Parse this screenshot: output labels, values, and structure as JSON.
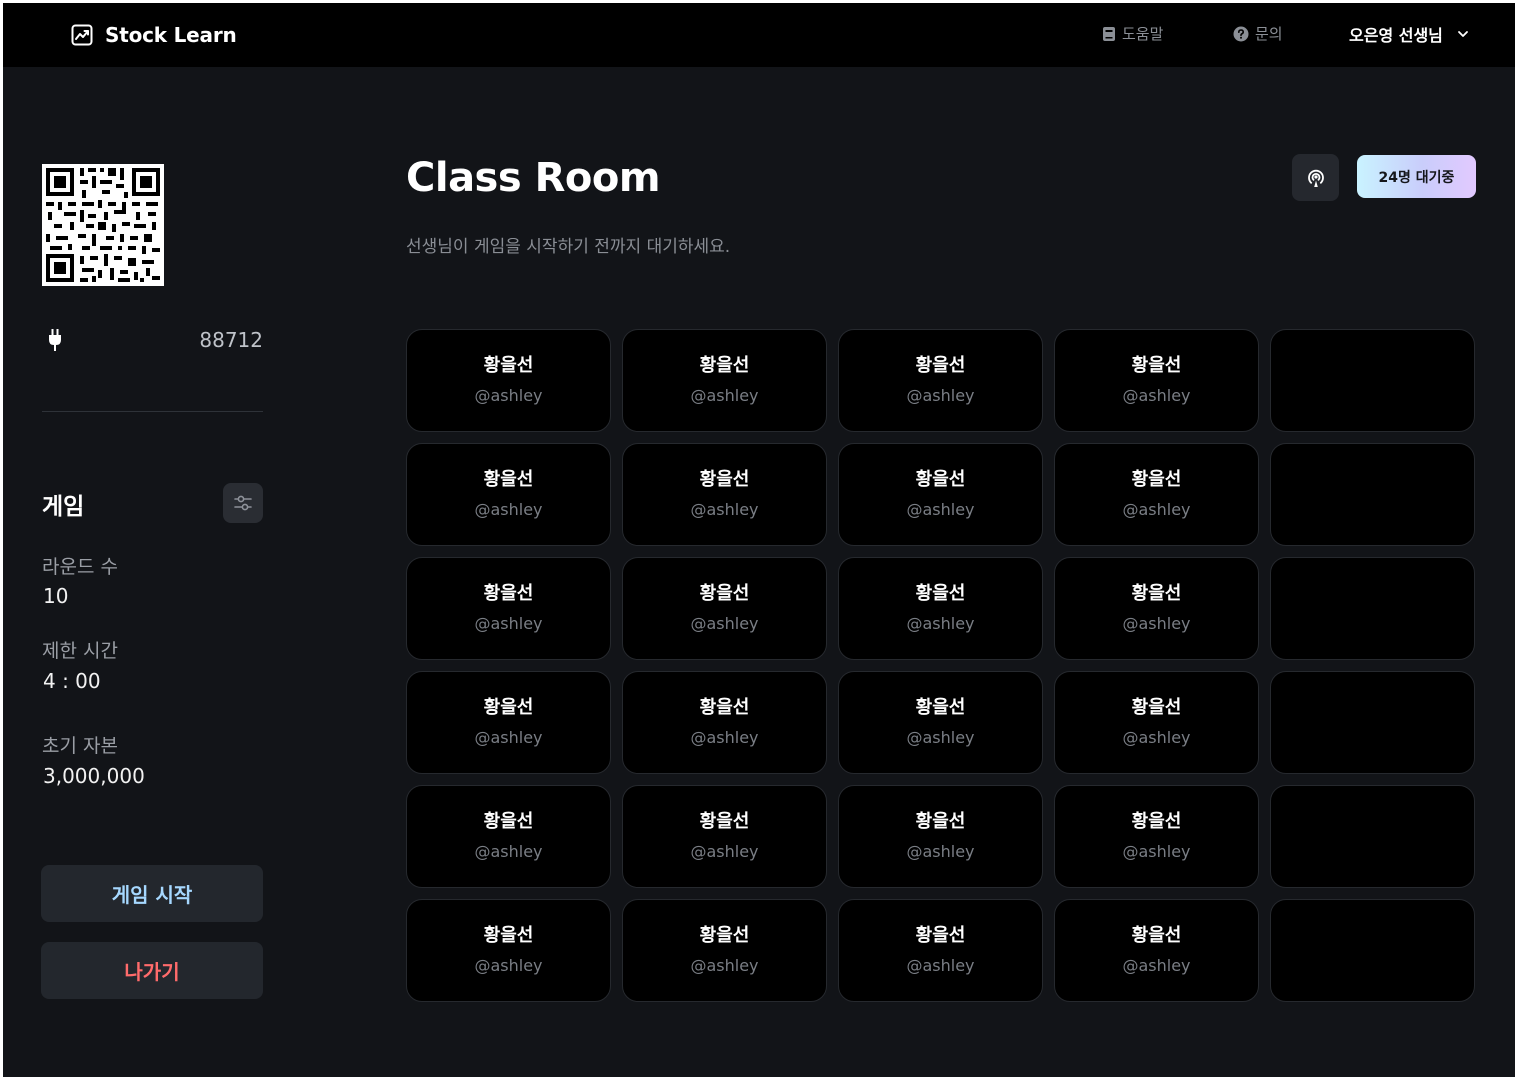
{
  "app": {
    "brand": "Stock Learn",
    "brand_icon": "chart-trend-icon"
  },
  "nav": {
    "help_label": "도움말",
    "help_icon": "book-icon",
    "ask_label": "문의",
    "ask_icon": "question-circle-icon",
    "user_label": "오은영 선생님",
    "user_icon": "chevron-down-icon"
  },
  "sidebar": {
    "qr_icon": "qr-code",
    "pin_icon": "plug-icon",
    "pin": "88712",
    "game_title": "게임",
    "settings_icon": "sliders-icon",
    "settings": [
      {
        "label": "라운드 수",
        "value": "10"
      },
      {
        "label": "제한 시간",
        "value": "4 : 00"
      },
      {
        "label": "초기 자본",
        "value": "3,000,000"
      }
    ],
    "start_button": "게임 시작",
    "exit_button": "나가기"
  },
  "main": {
    "title": "Class Room",
    "subtitle": "선생님이 게임을 시작하기 전까지 대기하세요.",
    "broadcast_icon": "broadcast-icon",
    "waiting_badge": "24명 대기중",
    "colors": {
      "badge_gradient": [
        "#c9f3ff",
        "#c9cdfb",
        "#e2c9ff"
      ],
      "start_button_text": "#a6d8ff",
      "exit_button_text": "#ff6b6b",
      "background": "#121418"
    },
    "students": [
      [
        {
          "name": "황을선",
          "handle": "@ashley"
        },
        {
          "name": "황을선",
          "handle": "@ashley"
        },
        {
          "name": "황을선",
          "handle": "@ashley"
        },
        {
          "name": "황을선",
          "handle": "@ashley"
        },
        null
      ],
      [
        {
          "name": "황을선",
          "handle": "@ashley"
        },
        {
          "name": "황을선",
          "handle": "@ashley"
        },
        {
          "name": "황을선",
          "handle": "@ashley"
        },
        {
          "name": "황을선",
          "handle": "@ashley"
        },
        null
      ],
      [
        {
          "name": "황을선",
          "handle": "@ashley"
        },
        {
          "name": "황을선",
          "handle": "@ashley"
        },
        {
          "name": "황을선",
          "handle": "@ashley"
        },
        {
          "name": "황을선",
          "handle": "@ashley"
        },
        null
      ],
      [
        {
          "name": "황을선",
          "handle": "@ashley"
        },
        {
          "name": "황을선",
          "handle": "@ashley"
        },
        {
          "name": "황을선",
          "handle": "@ashley"
        },
        {
          "name": "황을선",
          "handle": "@ashley"
        },
        null
      ],
      [
        {
          "name": "황을선",
          "handle": "@ashley"
        },
        {
          "name": "황을선",
          "handle": "@ashley"
        },
        {
          "name": "황을선",
          "handle": "@ashley"
        },
        {
          "name": "황을선",
          "handle": "@ashley"
        },
        null
      ],
      [
        {
          "name": "황을선",
          "handle": "@ashley"
        },
        {
          "name": "황을선",
          "handle": "@ashley"
        },
        {
          "name": "황을선",
          "handle": "@ashley"
        },
        {
          "name": "황을선",
          "handle": "@ashley"
        },
        null
      ]
    ]
  }
}
